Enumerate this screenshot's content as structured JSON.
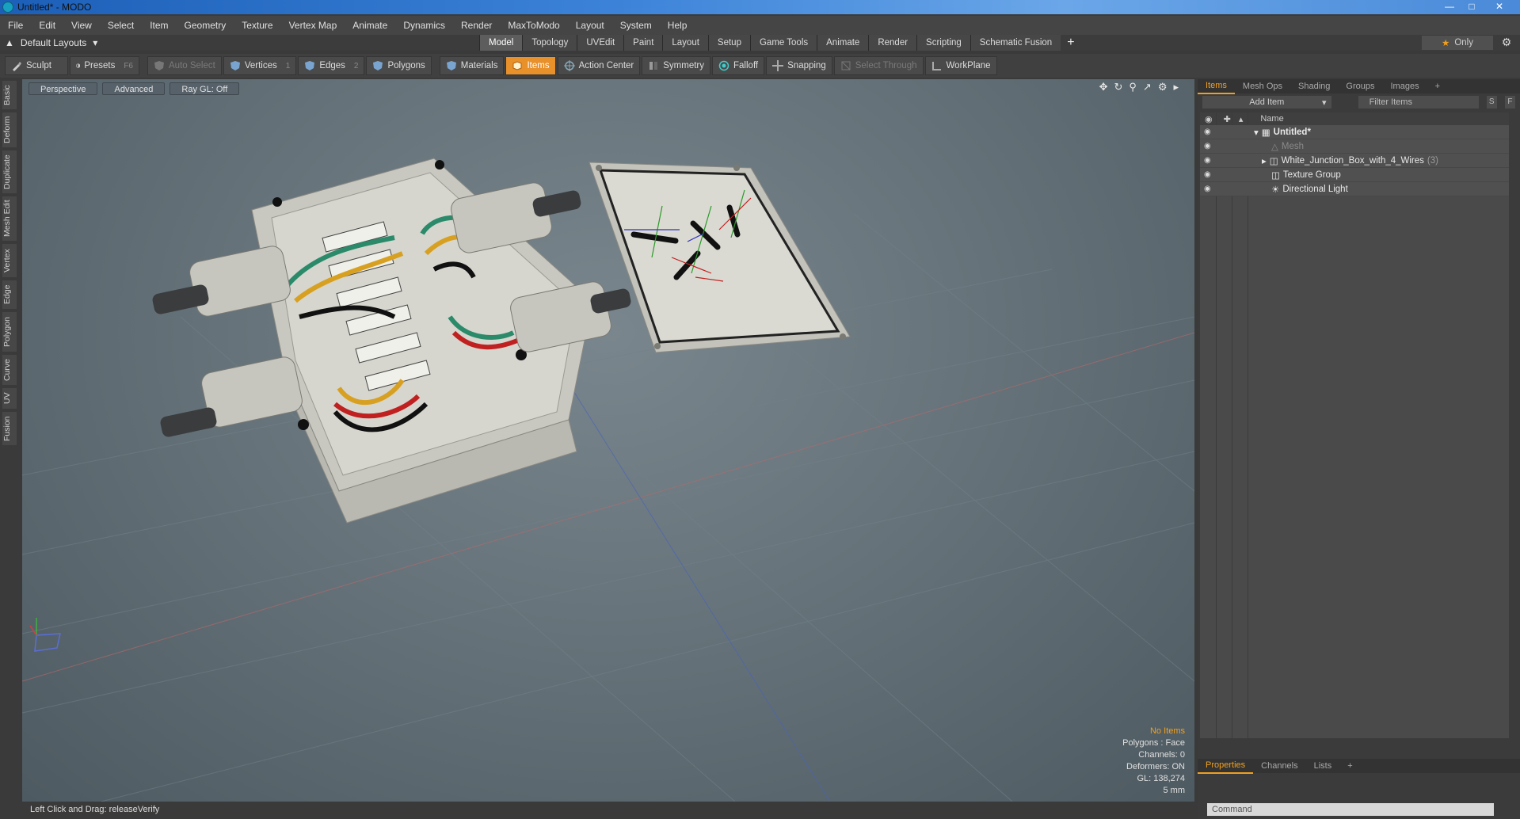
{
  "window": {
    "title": "Untitled* - MODO"
  },
  "menu": [
    "File",
    "Edit",
    "View",
    "Select",
    "Item",
    "Geometry",
    "Texture",
    "Vertex Map",
    "Animate",
    "Dynamics",
    "Render",
    "MaxToModo",
    "Layout",
    "System",
    "Help"
  ],
  "layout": {
    "selector": "Default Layouts",
    "tabs": [
      "Model",
      "Topology",
      "UVEdit",
      "Paint",
      "Layout",
      "Setup",
      "Game Tools",
      "Animate",
      "Render",
      "Scripting",
      "Schematic Fusion"
    ],
    "active_tab": "Model",
    "only_label": "Only"
  },
  "toolbar": {
    "sculpt": "Sculpt",
    "presets": "Presets",
    "presets_key": "F6",
    "auto_select": "Auto Select",
    "vertices": "Vertices",
    "vertices_key": "1",
    "edges": "Edges",
    "edges_key": "2",
    "polygons": "Polygons",
    "materials": "Materials",
    "items": "Items",
    "action_center": "Action Center",
    "symmetry": "Symmetry",
    "falloff": "Falloff",
    "snapping": "Snapping",
    "select_through": "Select Through",
    "workplane": "WorkPlane"
  },
  "left_tabs": [
    "Basic",
    "Deform",
    "Duplicate",
    "Mesh Edit",
    "Vertex",
    "Edge",
    "Polygon",
    "Curve",
    "UV",
    "Fusion"
  ],
  "viewport": {
    "view": "Perspective",
    "shading": "Advanced",
    "raygl": "Ray GL: Off",
    "info": {
      "no_items": "No Items",
      "polygons": "Polygons : Face",
      "channels": "Channels: 0",
      "deformers": "Deformers: ON",
      "gl": "GL: 138,274",
      "scale": "5 mm"
    }
  },
  "right_panel": {
    "tabs": [
      "Items",
      "Mesh Ops",
      "Shading",
      "Groups",
      "Images"
    ],
    "active_tab": "Items",
    "add_item": "Add Item",
    "filter": "Filter Items",
    "s_btn": "S",
    "f_btn": "F",
    "col_name": "Name",
    "tree": [
      {
        "label": "Untitled*",
        "indent": 0
      },
      {
        "label": "Mesh",
        "indent": 1
      },
      {
        "label": "White_Junction_Box_with_4_Wires",
        "count": "(3)",
        "indent": 1
      },
      {
        "label": "Texture Group",
        "indent": 1
      },
      {
        "label": "Directional Light",
        "indent": 1
      }
    ]
  },
  "bottom_panel": {
    "tabs": [
      "Properties",
      "Channels",
      "Lists"
    ],
    "active_tab": "Properties",
    "command_placeholder": "Command"
  },
  "status": {
    "hint": "Left Click and Drag:  releaseVerify"
  }
}
